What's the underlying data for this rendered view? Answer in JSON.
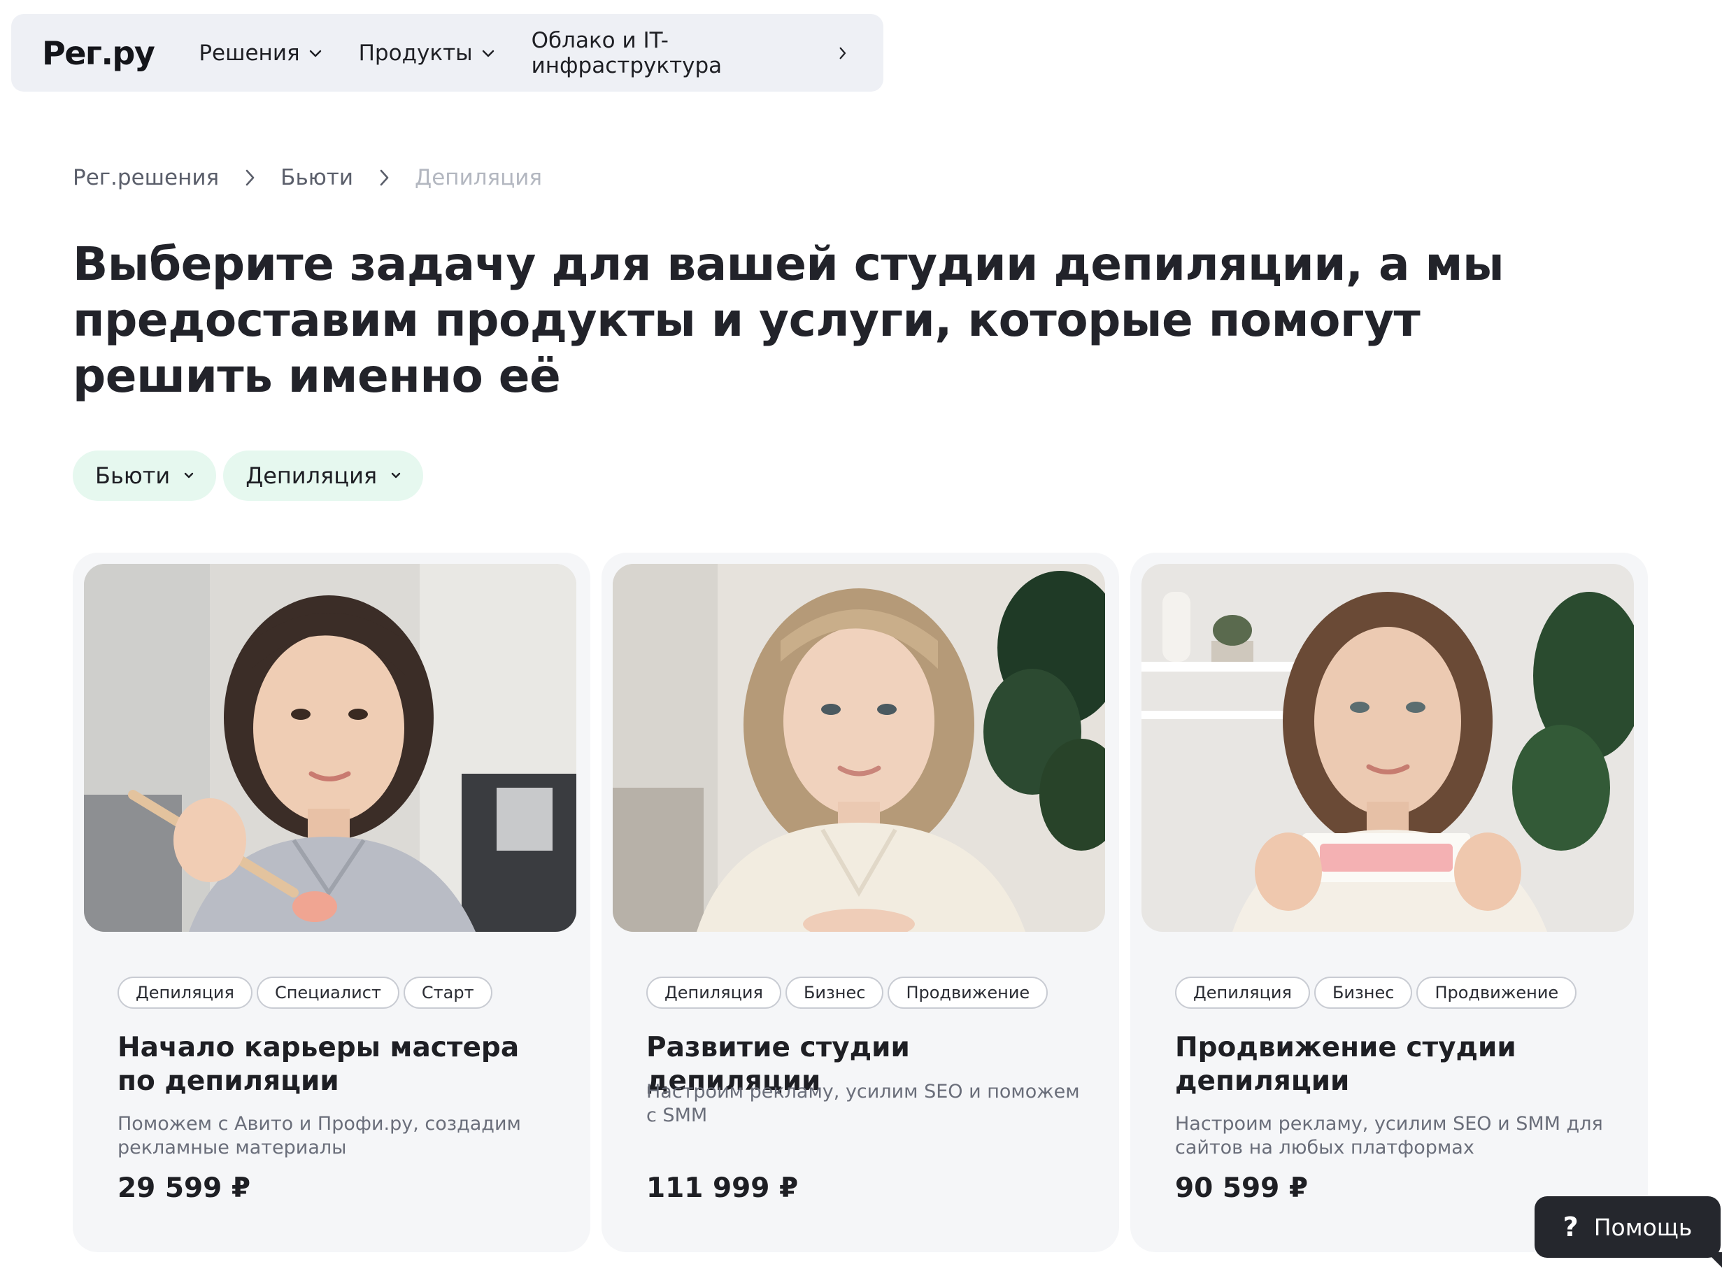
{
  "header": {
    "logo": "Рег.ру",
    "nav": [
      {
        "label": "Решения",
        "icon": "chevron-down-icon"
      },
      {
        "label": "Продукты",
        "icon": "chevron-down-icon"
      },
      {
        "label": "Облако и IT-инфраструктура",
        "icon": "chevron-right-icon"
      }
    ]
  },
  "breadcrumb": [
    {
      "label": "Рег.решения"
    },
    {
      "label": "Бьюти"
    },
    {
      "label": "Депиляция",
      "current": true
    }
  ],
  "page_title": "Выберите задачу для вашей студии депиляции, а мы предоставим продукты и услуги, которые помогут решить именно её",
  "filters": [
    {
      "label": "Бьюти",
      "icon": "chevron-down-icon"
    },
    {
      "label": "Депиляция",
      "icon": "chevron-down-icon"
    }
  ],
  "cards": [
    {
      "image": "photo-woman-wax-spatula",
      "tags": [
        "Депиляция",
        "Специалист",
        "Старт"
      ],
      "title": "Начало карьеры мастера по депиляции",
      "description": "Поможем с Авито и Профи.ру, создадим рекламные материалы",
      "price": "29 599 ₽"
    },
    {
      "image": "photo-woman-studio-owner",
      "tags": [
        "Депиляция",
        "Бизнес",
        "Продвижение"
      ],
      "title": "Развитие студии депиляции",
      "description": "Настроим рекламу, усилим SEO и поможем с SMM",
      "price": "111 999 ₽"
    },
    {
      "image": "photo-woman-wax-strip",
      "tags": [
        "Депиляция",
        "Бизнес",
        "Продвижение"
      ],
      "title": "Продвижение студии депиляции",
      "description": "Настроим рекламу, усилим SEO и SMM для сайтов на любых платформах",
      "price": "90 599 ₽"
    }
  ],
  "help": {
    "icon": "question-icon",
    "label": "Помощь"
  },
  "colors": {
    "header_bg": "#eef0f5",
    "chip_bg": "#e6f8ef",
    "card_bg": "#f5f6f8",
    "help_bg": "#25272d"
  }
}
